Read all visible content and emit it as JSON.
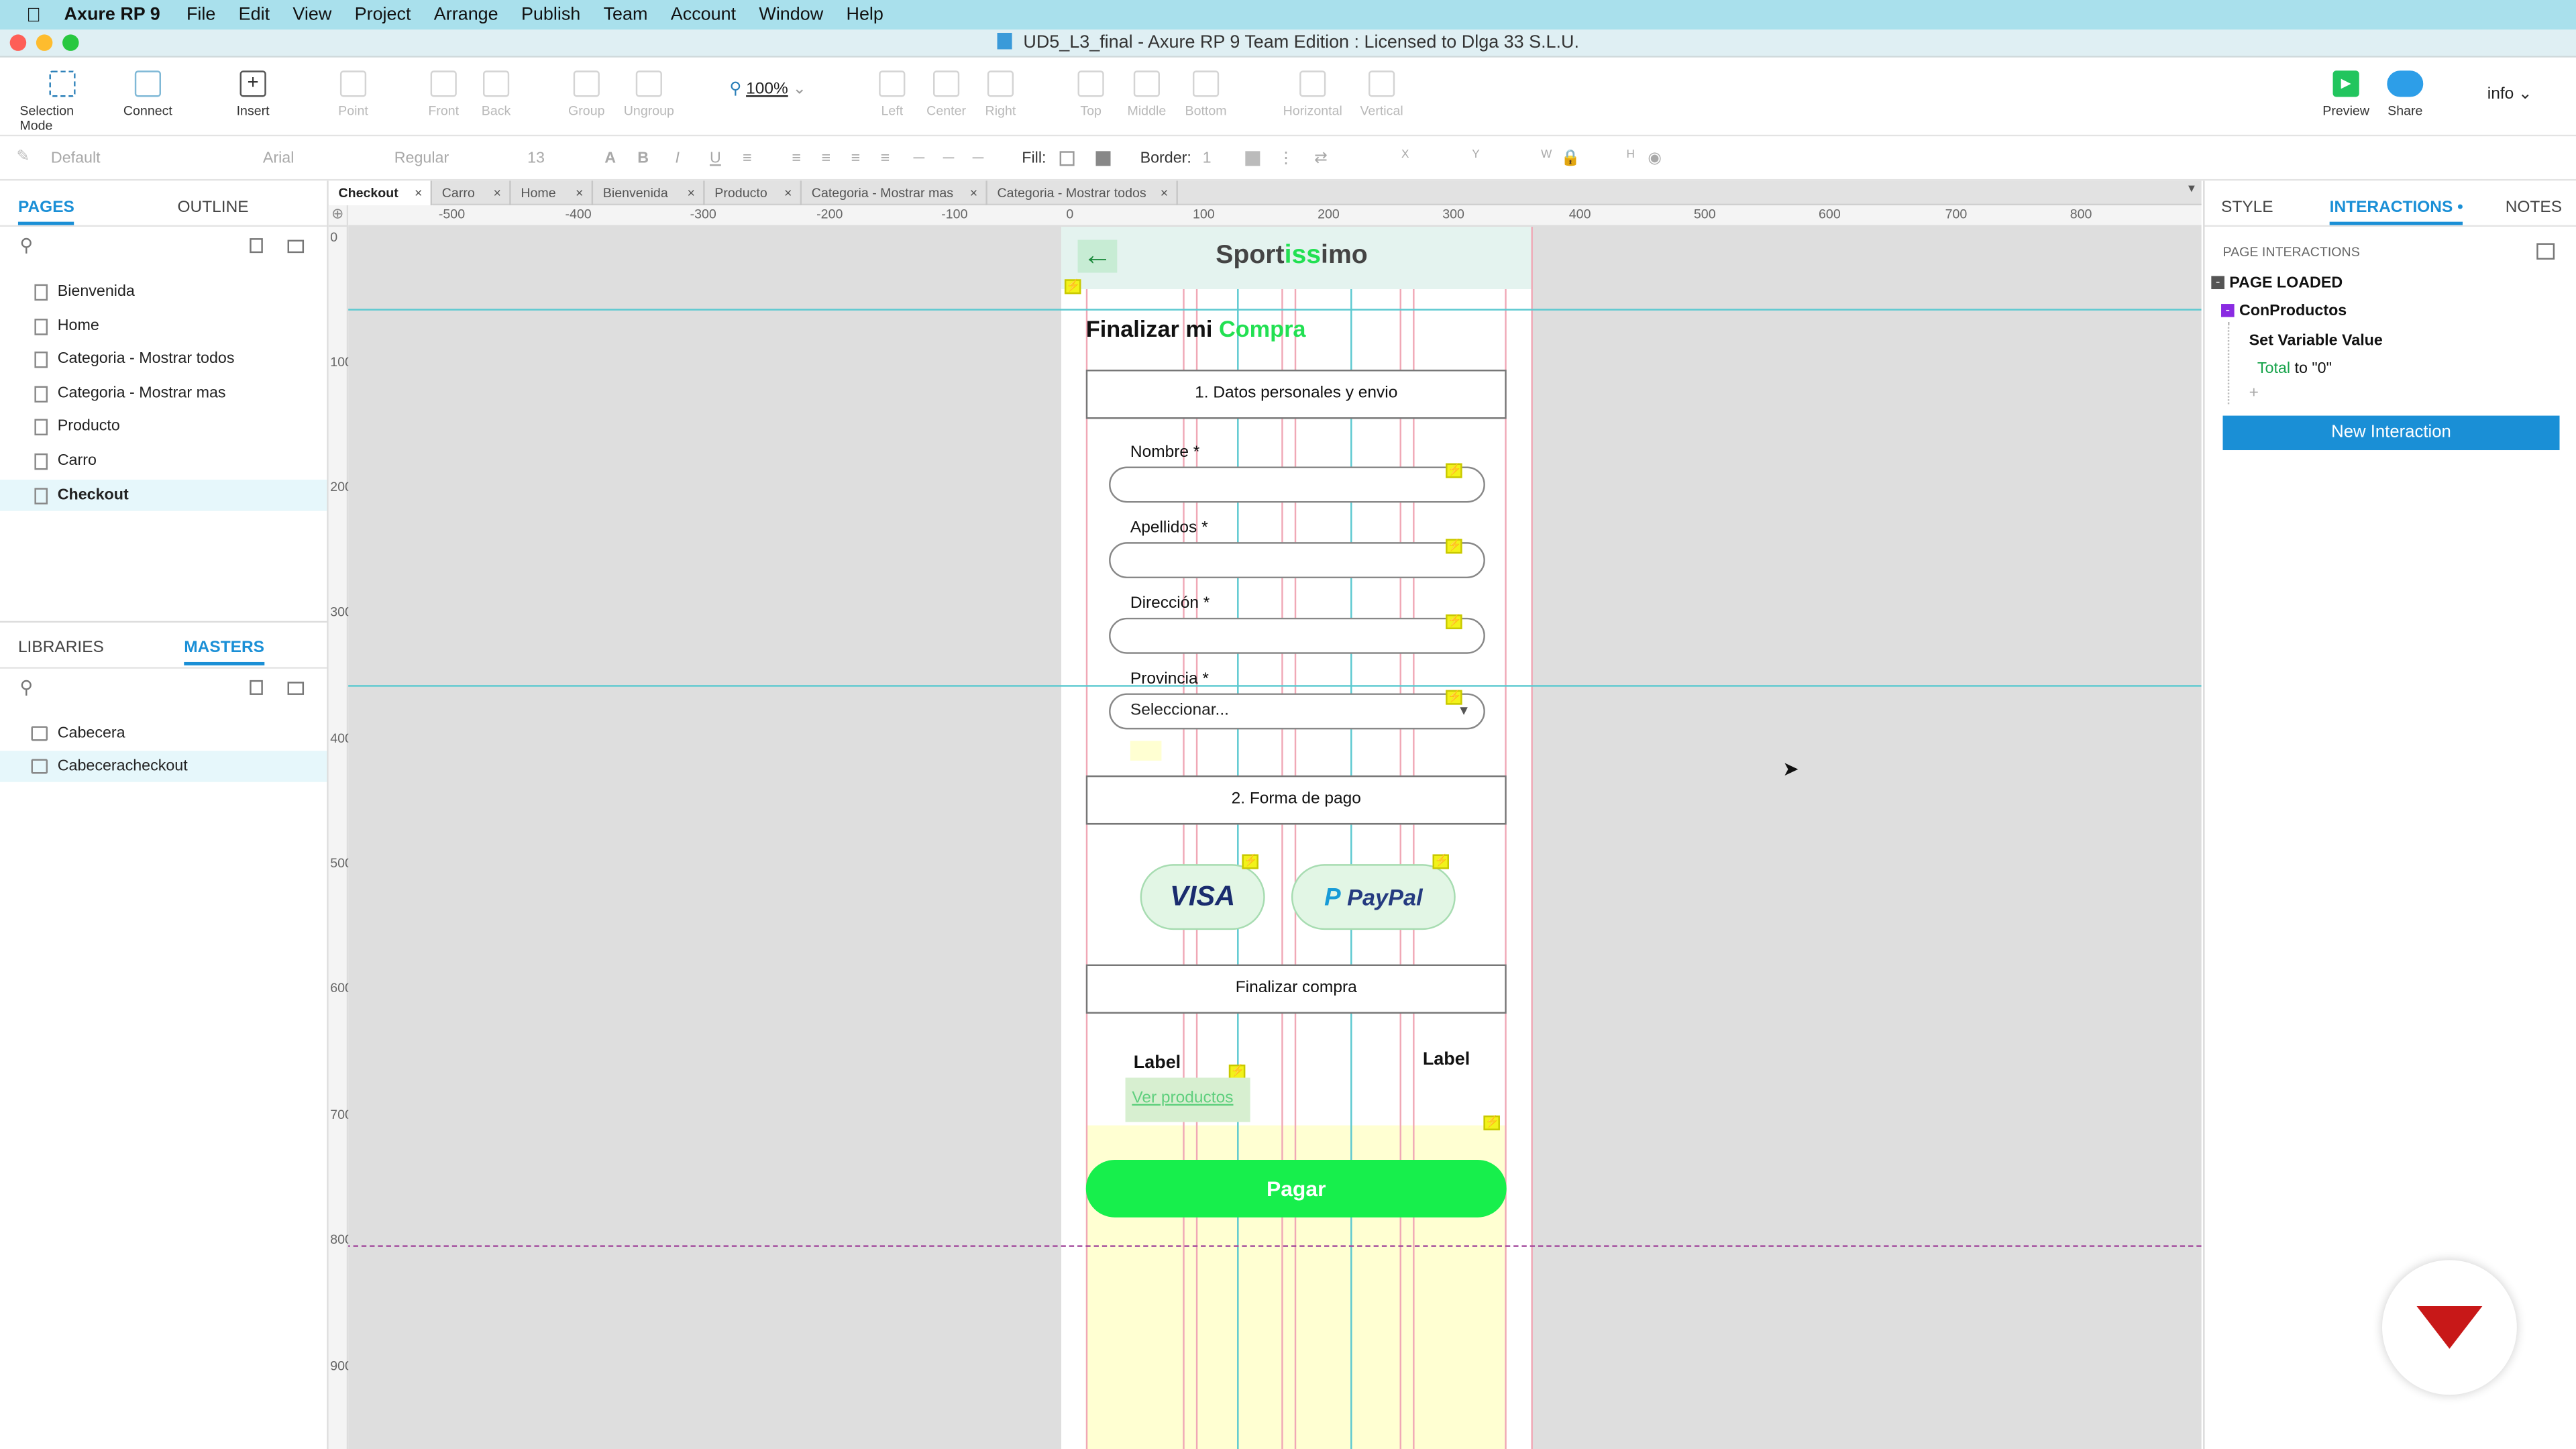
{
  "menubar": {
    "app": "Axure RP 9",
    "items": [
      "File",
      "Edit",
      "View",
      "Project",
      "Arrange",
      "Publish",
      "Team",
      "Account",
      "Window",
      "Help"
    ]
  },
  "window": {
    "title": "UD5_L3_final - Axure RP 9 Team Edition : Licensed to Dlga 33 S.L.U."
  },
  "toolbar": {
    "selection_mode": "Selection Mode",
    "connect": "Connect",
    "insert": "Insert",
    "point": "Point",
    "front": "Front",
    "back": "Back",
    "group": "Group",
    "ungroup": "Ungroup",
    "zoom": "100%",
    "left": "Left",
    "center": "Center",
    "right": "Right",
    "top": "Top",
    "middle": "Middle",
    "bottom": "Bottom",
    "horizontal": "Horizontal",
    "vertical": "Vertical",
    "preview": "Preview",
    "share": "Share",
    "user": "info"
  },
  "format": {
    "style": "Default",
    "font": "Arial",
    "weight": "Regular",
    "size": "13",
    "fill_label": "Fill:",
    "border_label": "Border:",
    "border_value": "1",
    "x": "X",
    "y": "Y",
    "w": "W",
    "h": "H"
  },
  "left_panel": {
    "tabs": [
      "PAGES",
      "OUTLINE"
    ],
    "pages": [
      "Bienvenida",
      "Home",
      "Categoria - Mostrar todos",
      "Categoria - Mostrar mas",
      "Producto",
      "Carro",
      "Checkout"
    ],
    "selected_page": "Checkout",
    "lib_tabs": [
      "LIBRARIES",
      "MASTERS"
    ],
    "masters": [
      "Cabecera",
      "Cabeceracheckout"
    ]
  },
  "doc_tabs": [
    "Checkout",
    "Carro",
    "Home",
    "Bienvenida",
    "Producto",
    "Categoria - Mostrar mas",
    "Categoria - Mostrar todos"
  ],
  "ruler": {
    "h": [
      "-500",
      "-400",
      "-300",
      "-200",
      "-100",
      "0",
      "100",
      "200",
      "300",
      "400",
      "500",
      "600",
      "700",
      "800"
    ],
    "v": [
      "0",
      "100",
      "200",
      "300",
      "400",
      "500",
      "600",
      "700",
      "800",
      "900"
    ]
  },
  "mockup": {
    "brand_a": "Sport",
    "brand_b": "iss",
    "brand_c": "imo",
    "heading_a": "Finalizar mi ",
    "heading_b": "Compra",
    "section1": "1. Datos personales y envio",
    "nombre": "Nombre *",
    "apellidos": "Apellidos *",
    "direccion": "Dirección *",
    "provincia": "Provincia *",
    "select_placeholder": "Seleccionar...",
    "section2": "2. Forma de pago",
    "visa": "VISA",
    "paypal": "PayPal",
    "section3": "Finalizar compra",
    "label1": "Label",
    "label2": "Label",
    "ver_productos": "Ver productos",
    "pay": "Pagar",
    "colors": {
      "brand_green": "#22e052",
      "pay_button": "#17ef4c"
    }
  },
  "right_panel": {
    "tabs": [
      "STYLE",
      "INTERACTIONS",
      "NOTES"
    ],
    "section": "PAGE INTERACTIONS",
    "event": "PAGE LOADED",
    "case": "ConProductos",
    "action": "Set Variable Value",
    "detail_a": "Total",
    "detail_b": " to \"0\"",
    "new_interaction": "New Interaction"
  }
}
